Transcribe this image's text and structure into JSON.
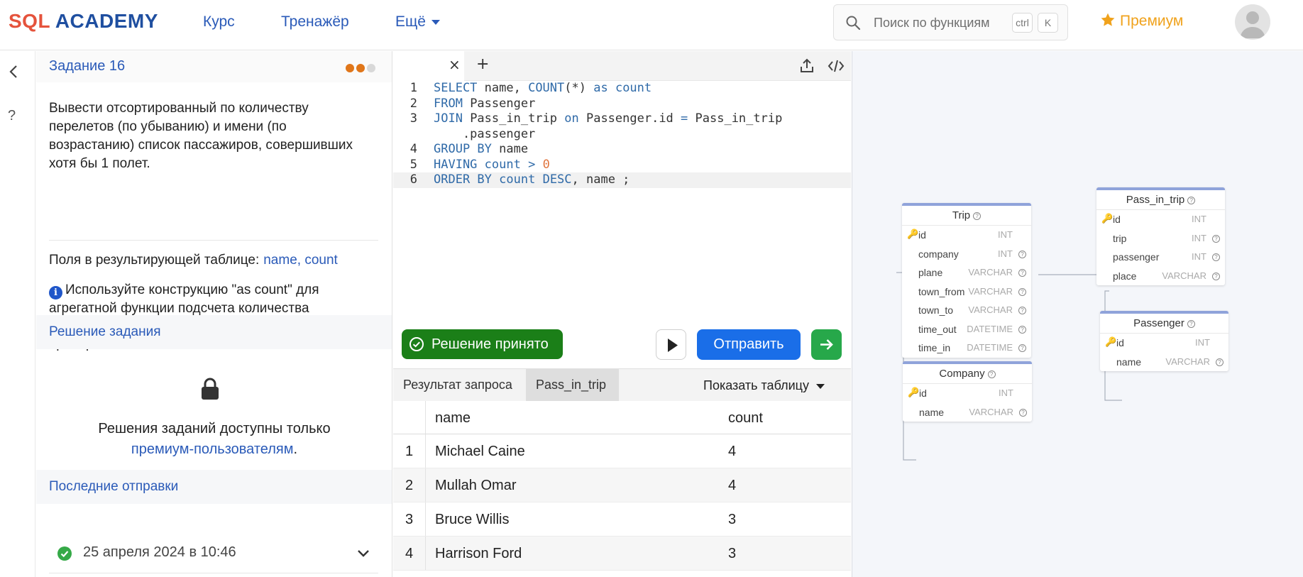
{
  "header": {
    "logo_sql": "SQL",
    "logo_academy": "ACADEMY",
    "nav": [
      "Курс",
      "Тренажёр",
      "Ещё"
    ],
    "search_placeholder": "Поиск по функциям",
    "kbd_ctrl": "ctrl",
    "kbd_k": "K",
    "premium_label": "Премиум"
  },
  "rail": {
    "help": "?"
  },
  "task": {
    "title": "Задание 16",
    "progress_dots": [
      "#e0761a",
      "#e0761a",
      "#d8d8d8"
    ],
    "description": "Вывести отсортированный по количеству перелетов (по убыванию) и имени (по возрастанию) список пассажиров, совершивших хотя бы 1 полет.",
    "fields_label": "Поля в результирующей таблице:",
    "fields_value": "name, count",
    "hint": "Используйте конструкцию \"as count\" для агрегатной функции подсчета количества перелетов. Это необходимо для корректной проверки.",
    "solution_title": "Решение задания",
    "premium_text": "Решения заданий доступны только",
    "premium_link": "премиум-пользователям",
    "premium_end": ".",
    "submissions_title": "Последние отправки",
    "submission_date": "25 апреля 2024 в 10:46"
  },
  "editor": {
    "lines": [
      {
        "n": "1",
        "tokens": [
          [
            "kw",
            "SELECT"
          ],
          [
            "t",
            " name, "
          ],
          [
            "kw",
            "COUNT"
          ],
          [
            "t",
            "(*) "
          ],
          [
            "kw",
            "as"
          ],
          [
            "t",
            " "
          ],
          [
            "kw",
            "count"
          ]
        ]
      },
      {
        "n": "2",
        "tokens": [
          [
            "kw",
            "FROM"
          ],
          [
            "t",
            " Passenger"
          ]
        ]
      },
      {
        "n": "3",
        "tokens": [
          [
            "kw",
            "JOIN"
          ],
          [
            "t",
            " Pass_in_trip "
          ],
          [
            "kw",
            "on"
          ],
          [
            "t",
            " Passenger.id "
          ],
          [
            "kw",
            "="
          ],
          [
            "t",
            " Pass_in_trip"
          ]
        ]
      },
      {
        "n": "",
        "tokens": [
          [
            "t",
            "    .passenger"
          ]
        ]
      },
      {
        "n": "4",
        "tokens": [
          [
            "kw",
            "GROUP BY"
          ],
          [
            "t",
            " name"
          ]
        ]
      },
      {
        "n": "5",
        "tokens": [
          [
            "kw",
            "HAVING"
          ],
          [
            "t",
            " "
          ],
          [
            "kw",
            "count"
          ],
          [
            "t",
            " "
          ],
          [
            "kw",
            ">"
          ],
          [
            "t",
            " "
          ],
          [
            "num",
            "0"
          ]
        ]
      },
      {
        "n": "6",
        "tokens": [
          [
            "kw",
            "ORDER BY"
          ],
          [
            "t",
            " "
          ],
          [
            "kw",
            "count"
          ],
          [
            "t",
            " "
          ],
          [
            "kw",
            "DESC"
          ],
          [
            "t",
            ", name ;"
          ]
        ]
      }
    ],
    "accepted_label": "Решение принято",
    "send_label": "Отправить"
  },
  "results": {
    "tab_result": "Результат запроса",
    "tab_table": "Pass_in_trip",
    "show_table": "Показать таблицу",
    "columns": [
      "name",
      "count"
    ],
    "rows": [
      {
        "n": "1",
        "name": "Michael Caine",
        "count": "4"
      },
      {
        "n": "2",
        "name": "Mullah Omar",
        "count": "4"
      },
      {
        "n": "3",
        "name": "Bruce Willis",
        "count": "3"
      },
      {
        "n": "4",
        "name": "Harrison Ford",
        "count": "3"
      }
    ]
  },
  "schema": {
    "tables": [
      {
        "name": "Trip",
        "fields": [
          {
            "name": "id",
            "type": "INT",
            "pk": true
          },
          {
            "name": "company",
            "type": "INT"
          },
          {
            "name": "plane",
            "type": "VARCHAR"
          },
          {
            "name": "town_from",
            "type": "VARCHAR"
          },
          {
            "name": "town_to",
            "type": "VARCHAR"
          },
          {
            "name": "time_out",
            "type": "DATETIME"
          },
          {
            "name": "time_in",
            "type": "DATETIME"
          }
        ]
      },
      {
        "name": "Pass_in_trip",
        "fields": [
          {
            "name": "id",
            "type": "INT",
            "pk": true
          },
          {
            "name": "trip",
            "type": "INT"
          },
          {
            "name": "passenger",
            "type": "INT"
          },
          {
            "name": "place",
            "type": "VARCHAR"
          }
        ]
      },
      {
        "name": "Passenger",
        "fields": [
          {
            "name": "id",
            "type": "INT",
            "pk": true
          },
          {
            "name": "name",
            "type": "VARCHAR"
          }
        ]
      },
      {
        "name": "Company",
        "fields": [
          {
            "name": "id",
            "type": "INT",
            "pk": true
          },
          {
            "name": "name",
            "type": "VARCHAR"
          }
        ]
      }
    ]
  }
}
